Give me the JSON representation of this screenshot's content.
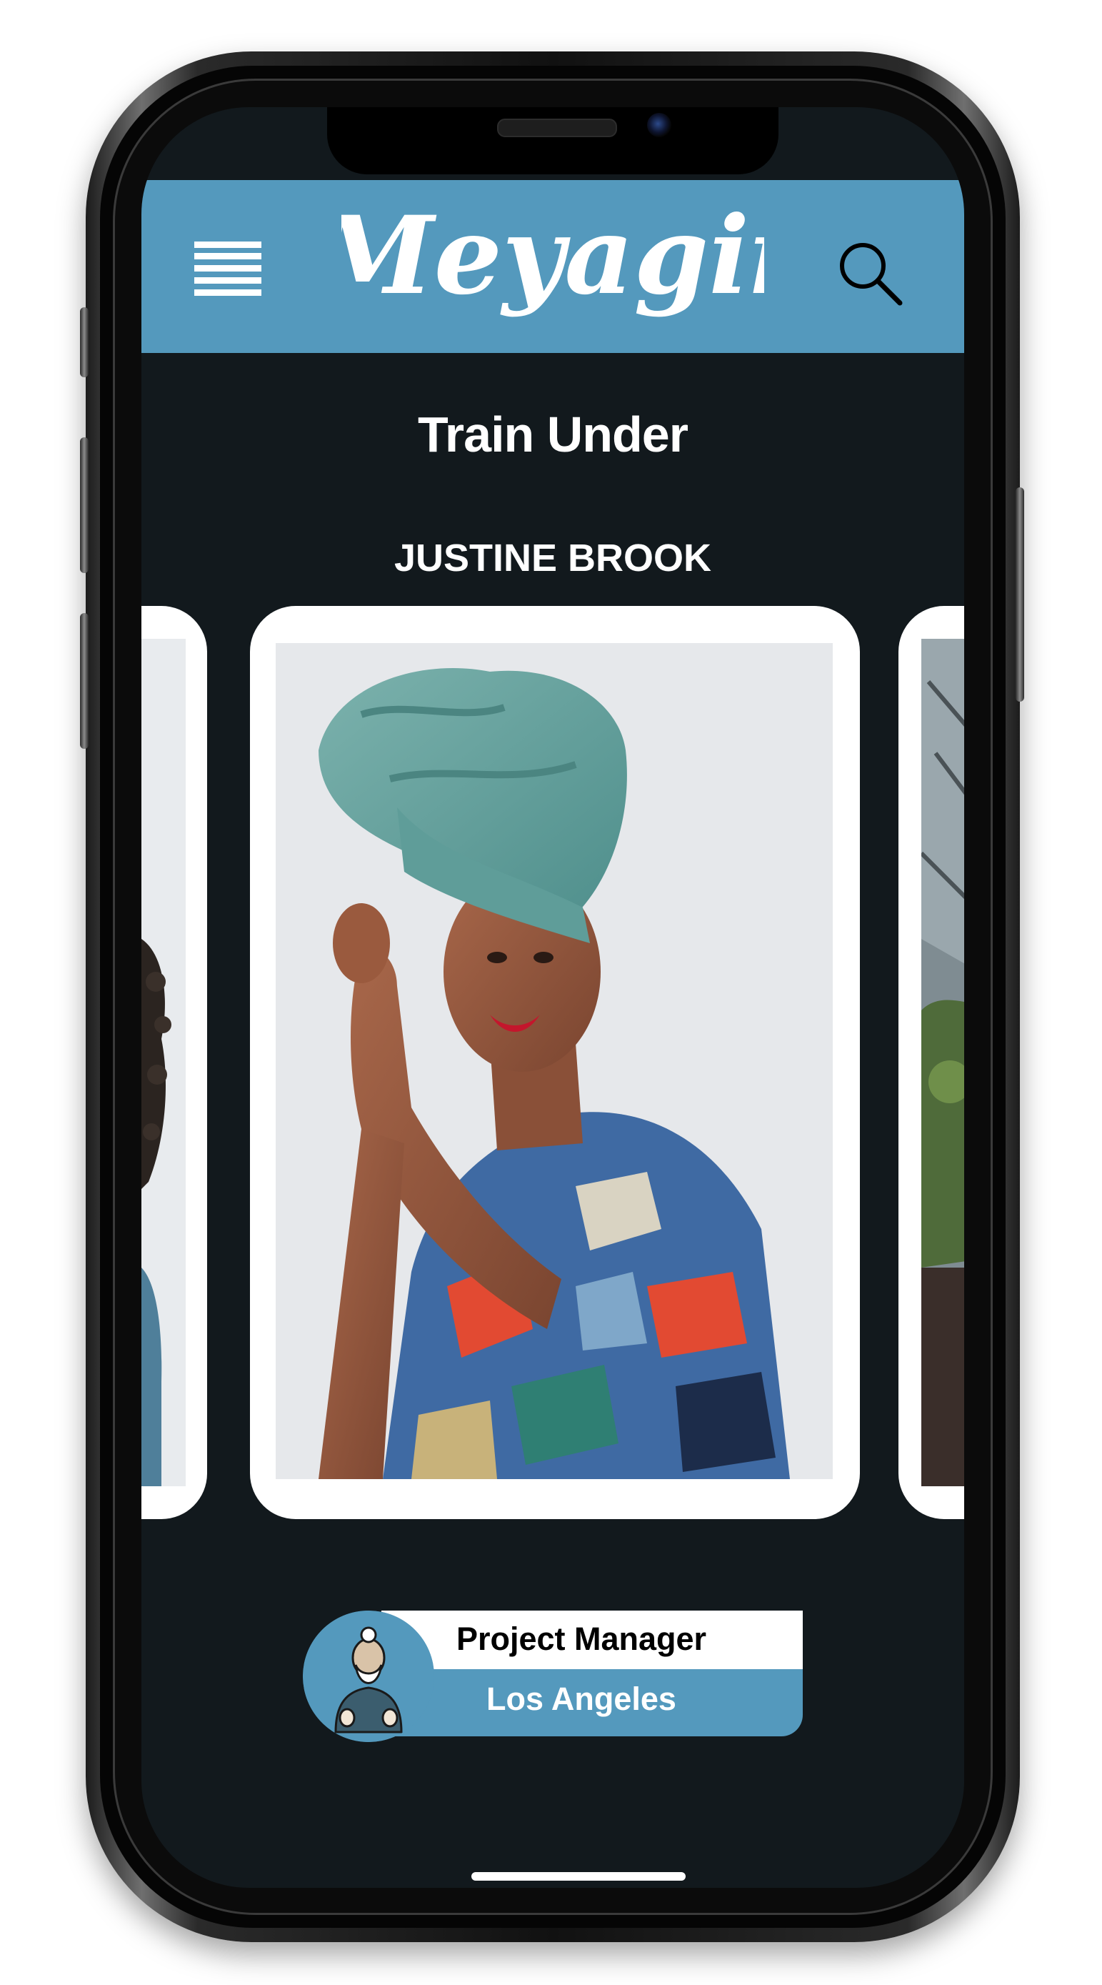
{
  "app": {
    "logo_text": "Meyagii",
    "brand_color": "#5499bd",
    "background_color": "#12191d"
  },
  "header": {
    "menu_icon": "hamburger-menu-icon",
    "search_icon": "search-icon"
  },
  "main": {
    "title": "Train Under",
    "mentor_name": "JUSTINE BROOK"
  },
  "carousel": {
    "cards": [
      {
        "position": "previous",
        "photo": "woman-curly-hair-photo"
      },
      {
        "position": "current",
        "photo": "woman-teal-headwrap-photo"
      },
      {
        "position": "next",
        "photo": "greenhouse-plants-photo"
      }
    ]
  },
  "badge": {
    "avatar_icon": "sensei-avatar-icon",
    "role": "Project Manager",
    "location": "Los Angeles"
  }
}
